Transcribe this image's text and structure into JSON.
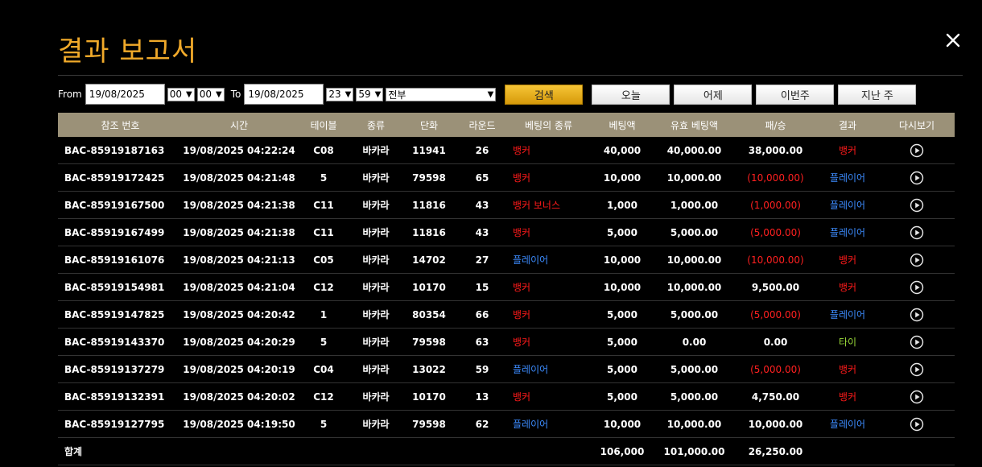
{
  "title": "결과 보고서",
  "filters": {
    "from_label": "From",
    "from_date": "19/08/2025",
    "from_hour": "00",
    "from_min": "00",
    "to_label": "To",
    "to_date": "19/08/2025",
    "to_hour": "23",
    "to_min": "59",
    "game_type": "전부",
    "search_label": "검색",
    "today_label": "오늘",
    "yesterday_label": "어제",
    "this_week_label": "이번주",
    "last_week_label": "지난 주"
  },
  "columns": [
    "참조 번호",
    "시간",
    "테이블",
    "종류",
    "단화",
    "라운드",
    "베팅의 종류",
    "베팅액",
    "유효 베팅액",
    "패/승",
    "결과",
    "다시보기"
  ],
  "rows": [
    {
      "ref": "BAC-85919187163",
      "time": "19/08/2025 04:22:24",
      "table": "C08",
      "kind": "바카라",
      "shoe": "11941",
      "round": "26",
      "bet_type": "뱅커",
      "bet_type_color": "red",
      "bet": "40,000",
      "valid": "40,000.00",
      "winloss": "38,000.00",
      "winloss_neg": false,
      "result": "뱅커",
      "result_color": "red"
    },
    {
      "ref": "BAC-85919172425",
      "time": "19/08/2025 04:21:48",
      "table": "5",
      "kind": "바카라",
      "shoe": "79598",
      "round": "65",
      "bet_type": "뱅커",
      "bet_type_color": "red",
      "bet": "10,000",
      "valid": "10,000.00",
      "winloss": "(10,000.00)",
      "winloss_neg": true,
      "result": "플레이어",
      "result_color": "blue"
    },
    {
      "ref": "BAC-85919167500",
      "time": "19/08/2025 04:21:38",
      "table": "C11",
      "kind": "바카라",
      "shoe": "11816",
      "round": "43",
      "bet_type": "뱅커 보너스",
      "bet_type_color": "red",
      "bet": "1,000",
      "valid": "1,000.00",
      "winloss": "(1,000.00)",
      "winloss_neg": true,
      "result": "플레이어",
      "result_color": "blue"
    },
    {
      "ref": "BAC-85919167499",
      "time": "19/08/2025 04:21:38",
      "table": "C11",
      "kind": "바카라",
      "shoe": "11816",
      "round": "43",
      "bet_type": "뱅커",
      "bet_type_color": "red",
      "bet": "5,000",
      "valid": "5,000.00",
      "winloss": "(5,000.00)",
      "winloss_neg": true,
      "result": "플레이어",
      "result_color": "blue"
    },
    {
      "ref": "BAC-85919161076",
      "time": "19/08/2025 04:21:13",
      "table": "C05",
      "kind": "바카라",
      "shoe": "14702",
      "round": "27",
      "bet_type": "플레이어",
      "bet_type_color": "blue",
      "bet": "10,000",
      "valid": "10,000.00",
      "winloss": "(10,000.00)",
      "winloss_neg": true,
      "result": "뱅커",
      "result_color": "red"
    },
    {
      "ref": "BAC-85919154981",
      "time": "19/08/2025 04:21:04",
      "table": "C12",
      "kind": "바카라",
      "shoe": "10170",
      "round": "15",
      "bet_type": "뱅커",
      "bet_type_color": "red",
      "bet": "10,000",
      "valid": "10,000.00",
      "winloss": "9,500.00",
      "winloss_neg": false,
      "result": "뱅커",
      "result_color": "red"
    },
    {
      "ref": "BAC-85919147825",
      "time": "19/08/2025 04:20:42",
      "table": "1",
      "kind": "바카라",
      "shoe": "80354",
      "round": "66",
      "bet_type": "뱅커",
      "bet_type_color": "red",
      "bet": "5,000",
      "valid": "5,000.00",
      "winloss": "(5,000.00)",
      "winloss_neg": true,
      "result": "플레이어",
      "result_color": "blue"
    },
    {
      "ref": "BAC-85919143370",
      "time": "19/08/2025 04:20:29",
      "table": "5",
      "kind": "바카라",
      "shoe": "79598",
      "round": "63",
      "bet_type": "뱅커",
      "bet_type_color": "red",
      "bet": "5,000",
      "valid": "0.00",
      "winloss": "0.00",
      "winloss_neg": false,
      "result": "타이",
      "result_color": "green"
    },
    {
      "ref": "BAC-85919137279",
      "time": "19/08/2025 04:20:19",
      "table": "C04",
      "kind": "바카라",
      "shoe": "13022",
      "round": "59",
      "bet_type": "플레이어",
      "bet_type_color": "blue",
      "bet": "5,000",
      "valid": "5,000.00",
      "winloss": "(5,000.00)",
      "winloss_neg": true,
      "result": "뱅커",
      "result_color": "red"
    },
    {
      "ref": "BAC-85919132391",
      "time": "19/08/2025 04:20:02",
      "table": "C12",
      "kind": "바카라",
      "shoe": "10170",
      "round": "13",
      "bet_type": "뱅커",
      "bet_type_color": "red",
      "bet": "5,000",
      "valid": "5,000.00",
      "winloss": "4,750.00",
      "winloss_neg": false,
      "result": "뱅커",
      "result_color": "red"
    },
    {
      "ref": "BAC-85919127795",
      "time": "19/08/2025 04:19:50",
      "table": "5",
      "kind": "바카라",
      "shoe": "79598",
      "round": "62",
      "bet_type": "플레이어",
      "bet_type_color": "blue",
      "bet": "10,000",
      "valid": "10,000.00",
      "winloss": "10,000.00",
      "winloss_neg": false,
      "result": "플레이어",
      "result_color": "blue"
    }
  ],
  "totals": {
    "label": "합계",
    "bet": "106,000",
    "valid": "101,000.00",
    "winloss": "26,250.00"
  },
  "colors": {
    "accent": "#f0a92a",
    "header_bg": "#9b9178",
    "red": "#ff1a1a",
    "blue": "#3c8cff",
    "green": "#9cdd3a"
  },
  "icons": {
    "close": "close-icon",
    "replay": "play-circle-icon"
  }
}
